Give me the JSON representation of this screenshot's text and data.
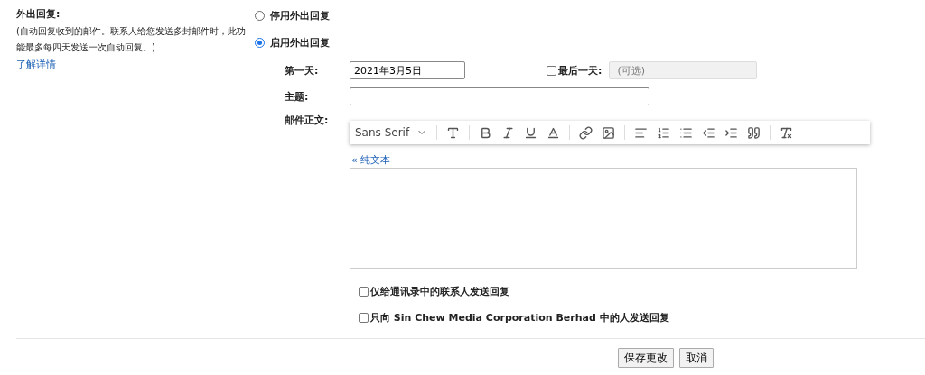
{
  "section": {
    "title": "外出回复:",
    "description": "(自动回复收到的邮件。联系人给您发送多封邮件时，此功能最多每四天发送一次自动回复。)",
    "learn_more": "了解详情"
  },
  "modes": [
    {
      "label": "停用外出回复",
      "selected": false
    },
    {
      "label": "启用外出回复",
      "selected": true
    }
  ],
  "first_day": {
    "label": "第一天:",
    "value": "2021年3月5日"
  },
  "last_day": {
    "label": "最后一天:",
    "checked": false,
    "placeholder": "(可选)"
  },
  "subject": {
    "label": "主题:"
  },
  "body": {
    "label": "邮件正文:",
    "font": "Sans Serif",
    "plain_text_link": "« 纯文本"
  },
  "options": [
    {
      "label": "仅给通讯录中的联系人发送回复",
      "checked": false
    },
    {
      "label": "只向 Sin Chew Media Corporation Berhad 中的人发送回复",
      "checked": false
    }
  ],
  "buttons": [
    "保存更改",
    "取消"
  ]
}
